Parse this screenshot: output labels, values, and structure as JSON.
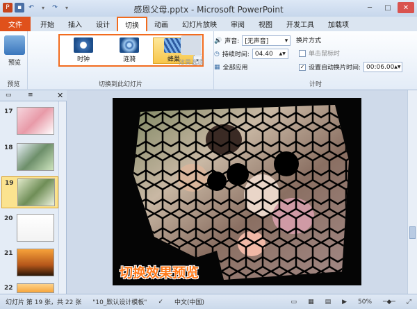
{
  "window": {
    "title": "感恩父母.pptx - Microsoft PowerPoint"
  },
  "tabs": [
    "开始",
    "插入",
    "设计",
    "切换",
    "动画",
    "幻灯片放映",
    "审阅",
    "视图",
    "开发工具",
    "加载项"
  ],
  "file_tab": "文件",
  "ribbon": {
    "preview": {
      "label": "预览",
      "group": "预览"
    },
    "transitions": [
      {
        "label": "时钟"
      },
      {
        "label": "涟漪"
      },
      {
        "label": "蜂巢"
      }
    ],
    "effect_options": "效果选项",
    "transition_group": "切换到此幻灯片",
    "sound_label": "声音:",
    "sound_value": "[无声音]",
    "duration_label": "持续时间:",
    "duration_value": "04.40",
    "apply_all": "全部应用",
    "advance_title": "换片方式",
    "on_click": "单击鼠标时",
    "auto_after": "设置自动换片时间:",
    "auto_time": "00:06.00",
    "timing_group": "计时"
  },
  "slides": [
    {
      "num": "17"
    },
    {
      "num": "18"
    },
    {
      "num": "19"
    },
    {
      "num": "20"
    },
    {
      "num": "21"
    },
    {
      "num": "22"
    }
  ],
  "slide_overlay": "切换效果预览",
  "status": {
    "slide_info": "幻灯片 第 19 张，共 22 张",
    "theme": "\"10_默认设计模板\"",
    "language": "中文(中国)",
    "zoom": "50%"
  },
  "colors": {
    "accent": "#f26b1d",
    "file_tab": "#e0511b"
  }
}
